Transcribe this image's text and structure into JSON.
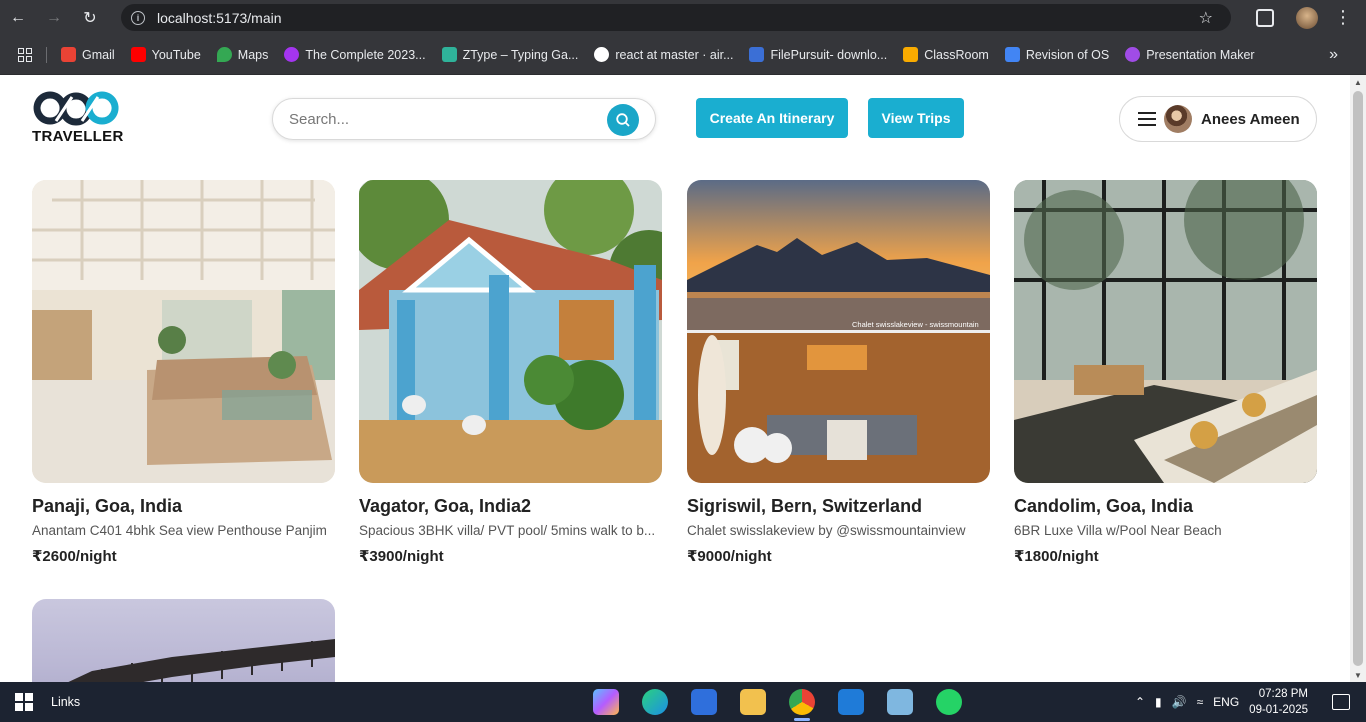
{
  "browser": {
    "url": "localhost:5173/main",
    "bookmarks": [
      {
        "label": "Gmail",
        "color": "#ea4335"
      },
      {
        "label": "YouTube",
        "color": "#ff0000"
      },
      {
        "label": "Maps",
        "color": "#34a853"
      },
      {
        "label": "The Complete 2023...",
        "color": "#a435f0"
      },
      {
        "label": "ZType – Typing Ga...",
        "color": "#2fb39a"
      },
      {
        "label": "react at master · air...",
        "color": "#ffffff"
      },
      {
        "label": "FilePursuit- downlo...",
        "color": "#3b6fd6"
      },
      {
        "label": "ClassRoom",
        "color": "#f9ab00"
      },
      {
        "label": "Revision of OS",
        "color": "#4285f4"
      },
      {
        "label": "Presentation Maker",
        "color": "#a04ce6"
      }
    ]
  },
  "header": {
    "brand": "TRAVELLER",
    "search_placeholder": "Search...",
    "create_button": "Create An Itinerary",
    "trips_button": "View Trips",
    "user_name": "Anees Ameen",
    "accent": "#1aaed0"
  },
  "listings": [
    {
      "location": "Panaji, Goa, India",
      "description": "Anantam C401 4bhk Sea view Penthouse Panjim",
      "price": "₹2600/night"
    },
    {
      "location": "Vagator, Goa, India2",
      "description": "Spacious 3BHK villa/ PVT pool/ 5mins walk to b...",
      "price": "₹3900/night"
    },
    {
      "location": "Sigriswil, Bern, Switzerland",
      "description": "Chalet swisslakeview by @swissmountainview",
      "price": "₹9000/night",
      "photo_caption": "Chalet swisslakeview - swissmountain"
    },
    {
      "location": "Candolim, Goa, India",
      "description": "6BR Luxe Villa w/Pool Near Beach",
      "price": "₹1800/night"
    }
  ],
  "taskbar": {
    "links_label": "Links",
    "language": "ENG",
    "time": "07:28 PM",
    "date": "09-01-2025"
  }
}
